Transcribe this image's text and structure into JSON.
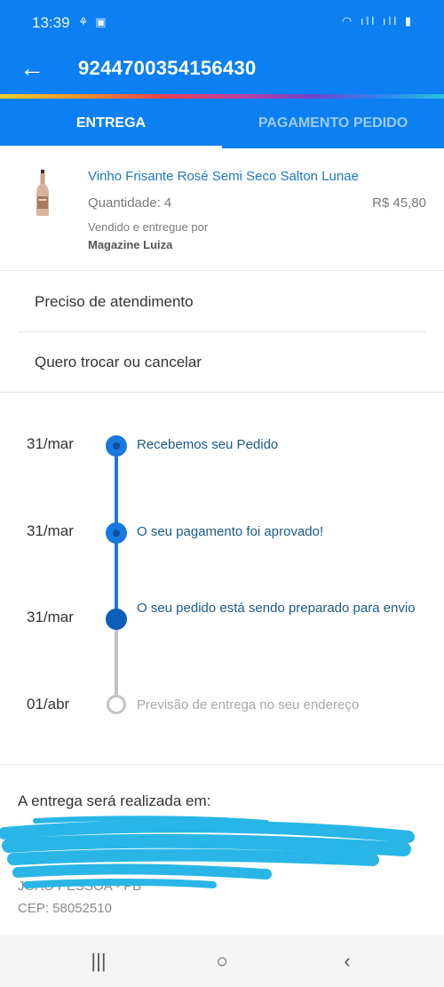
{
  "status_bar": {
    "time": "13:39",
    "left_icons": "⚘ ▣",
    "right_icons": "◠ ıll ıll ▮"
  },
  "app_bar": {
    "back_icon": "←",
    "title": "9244700354156430"
  },
  "tabs": [
    {
      "label": "ENTREGA",
      "active": true
    },
    {
      "label": "PAGAMENTO PEDIDO",
      "active": false
    }
  ],
  "product": {
    "name": "Vinho Frisante Rosé Semi Seco Salton Lunae",
    "quantity": "Quantidade: 4",
    "price": "R$ 45,80",
    "sold_by": "Vendido e entregue por",
    "seller": "Magazine Luiza"
  },
  "options": [
    {
      "label": "Preciso de atendimento"
    },
    {
      "label": "Quero trocar ou cancelar"
    }
  ],
  "timeline": [
    {
      "date": "31/mar",
      "text": "Recebemos seu Pedido",
      "status": "done"
    },
    {
      "date": "31/mar",
      "text": "O seu pagamento foi aprovado!",
      "status": "done"
    },
    {
      "date": "31/mar",
      "text": "O seu pedido está sendo preparado para envio",
      "status": "current"
    },
    {
      "date": "01/abr",
      "text": "Previsão de entrega no seu endereço",
      "status": "future"
    }
  ],
  "address": {
    "title": "A entrega será realizada em:",
    "city": "JOAO PESSOA - PB",
    "cep": "CEP: 58052510"
  },
  "nav": {
    "recents_icon": "|||",
    "home_icon": "○",
    "back_icon": "‹"
  },
  "colors": {
    "primary": "#0c7ff2",
    "timeline_active": "#1779df",
    "timeline_inactive": "#c4c4c4",
    "link": "#1c76c9",
    "scribble": "#29b6e6"
  }
}
